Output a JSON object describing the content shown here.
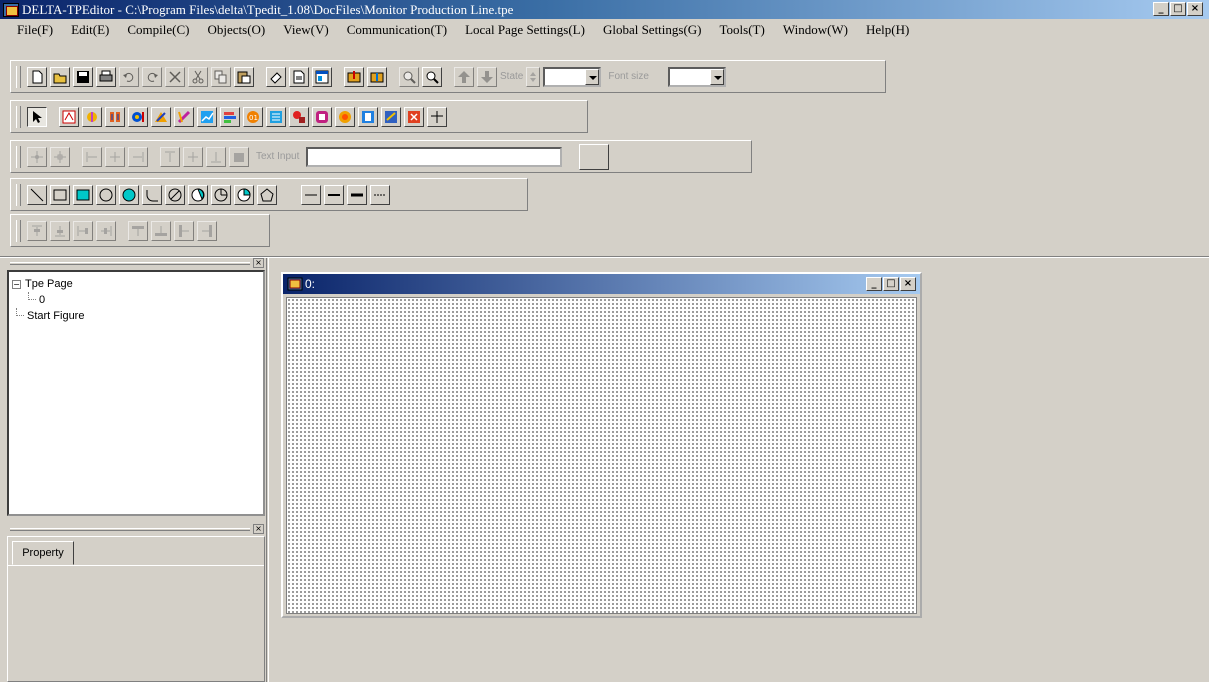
{
  "window": {
    "title": "DELTA-TPEditor - C:\\Program Files\\delta\\Tpedit_1.08\\DocFiles\\Monitor Production Line.tpe",
    "minimize": "_",
    "maximize": "□",
    "close": "×"
  },
  "menu": [
    "File(F)",
    "Edit(E)",
    "Compile(C)",
    "Objects(O)",
    "View(V)",
    "Communication(T)",
    "Local Page Settings(L)",
    "Global Settings(G)",
    "Tools(T)",
    "Window(W)",
    "Help(H)"
  ],
  "toolbar1": {
    "state_label": "State",
    "font_size_label": "Font size",
    "state_value": "",
    "font_size_value": ""
  },
  "toolbar3": {
    "text_input_label": "Text Input",
    "text_input_value": ""
  },
  "tree": {
    "root": "Tpe Page",
    "child": "0",
    "start": "Start Figure",
    "expander": "−"
  },
  "panes": {
    "close_glyph": "×"
  },
  "property_tab": "Property",
  "mdi_window": {
    "title": "0:",
    "minimize": "_",
    "maximize": "□",
    "close": "×"
  },
  "colors": {
    "titlebar_start": "#0a246a",
    "titlebar_end": "#a6caf0",
    "face": "#d4d0c8",
    "accent_cyan": "#00c8c8"
  }
}
